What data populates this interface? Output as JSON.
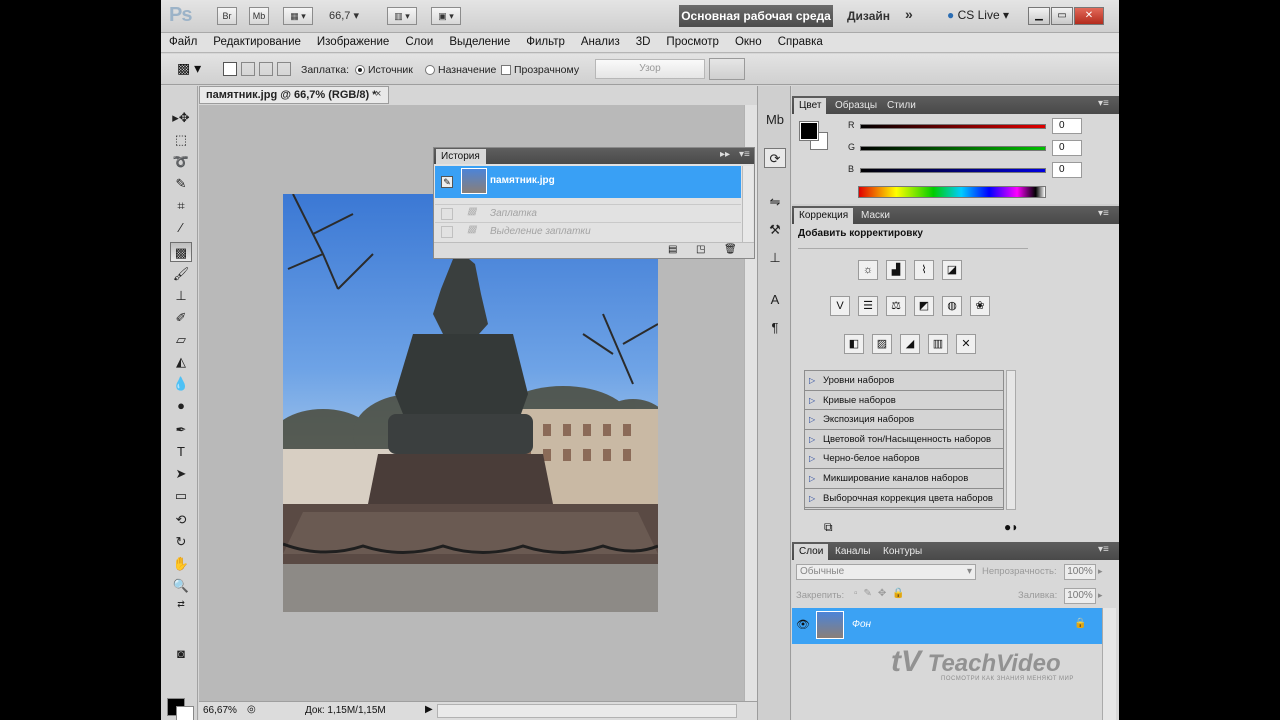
{
  "appbar": {
    "logo": "Ps",
    "bridge": "Br",
    "minibridge": "Mb",
    "zoom": "66,7",
    "workspace": "Основная рабочая среда",
    "design": "Дизайн",
    "more": "»",
    "cslive": "CS Live"
  },
  "menu": [
    "Файл",
    "Редактирование",
    "Изображение",
    "Слои",
    "Выделение",
    "Фильтр",
    "Анализ",
    "3D",
    "Просмотр",
    "Окно",
    "Справка"
  ],
  "options": {
    "patch_label": "Заплатка:",
    "source": "Источник",
    "destination": "Назначение",
    "transparent": "Прозрачному",
    "pattern_button": "Узор"
  },
  "document": {
    "tab_title": "памятник.jpg @ 66,7% (RGB/8) *",
    "close": "×",
    "zoom_status": "66,67%",
    "doc_status": "Док: 1,15M/1,15M"
  },
  "history": {
    "tab": "История",
    "snapshot": "памятник.jpg",
    "steps": [
      "Заплатка",
      "Выделение заплатки"
    ]
  },
  "color_panel": {
    "tabs": [
      "Цвет",
      "Образцы",
      "Стили"
    ],
    "channels": [
      {
        "label": "R",
        "value": "0",
        "color": "#d40000"
      },
      {
        "label": "G",
        "value": "0",
        "color": "#00b000"
      },
      {
        "label": "B",
        "value": "0",
        "color": "#0000d0"
      }
    ]
  },
  "adjust_panel": {
    "tabs": [
      "Коррекция",
      "Маски"
    ],
    "title": "Добавить корректировку",
    "presets": [
      "Уровни наборов",
      "Кривые наборов",
      "Экспозиция наборов",
      "Цветовой тон/Насыщенность наборов",
      "Черно-белое наборов",
      "Микширование каналов наборов",
      "Выборочная коррекция цвета наборов"
    ]
  },
  "layers_panel": {
    "tabs": [
      "Слои",
      "Каналы",
      "Контуры"
    ],
    "blend_mode": "Обычные",
    "opacity_label": "Непрозрачность:",
    "opacity_value": "100%",
    "lock_label": "Закрепить:",
    "fill_label": "Заливка:",
    "fill_value": "100%",
    "layer_name": "Фон"
  },
  "watermark": {
    "brand": "TeachVideo",
    "tagline": "ПОСМОТРИ КАК ЗНАНИЯ МЕНЯЮТ МИР"
  }
}
